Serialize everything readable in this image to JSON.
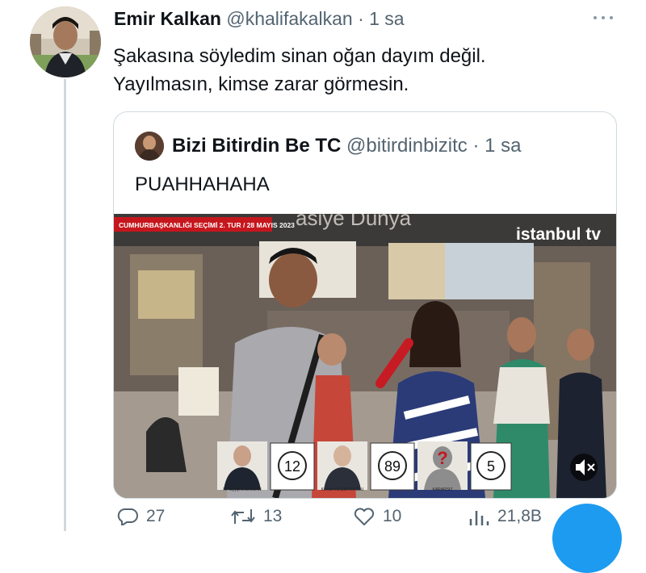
{
  "tweet": {
    "author_name": "Emir Kalkan",
    "handle": "@khalifakalkan",
    "time": "1 sa",
    "text_line1": "Şakasına söyledim sinan oğan dayım değil.",
    "text_line2": "Yayılmasın, kimse zarar görmesin."
  },
  "quote": {
    "author_name": "Bizi Bitirdin Be TC",
    "handle": "@bitirdinbizitc",
    "time": "1 sa",
    "text": "PUAHHAHAHA",
    "video": {
      "banner_text": "CUMHURBAŞKANLIĞI SEÇİMİ 2. TUR / 28 MAYIS 2023",
      "shop_sign": "asiye Dünya",
      "channel_logo": "istanbul tv",
      "poll": [
        {
          "name": "R. Tayyip ERDOĞAN",
          "value": "12"
        },
        {
          "name": "Kemal KILIÇDAROĞLU",
          "value": "89"
        },
        {
          "name": "KARARSIZ",
          "value": "5"
        }
      ]
    }
  },
  "actions": {
    "replies": "27",
    "retweets": "13",
    "likes": "10",
    "views": "21,8B"
  },
  "icons": {
    "more": "more-dots-icon",
    "reply": "reply-icon",
    "retweet": "retweet-icon",
    "like": "heart-icon",
    "views": "views-icon",
    "mute": "mute-icon"
  },
  "colors": {
    "accent": "#1d9bf0",
    "muted": "#536471",
    "border": "#cfd9de"
  }
}
